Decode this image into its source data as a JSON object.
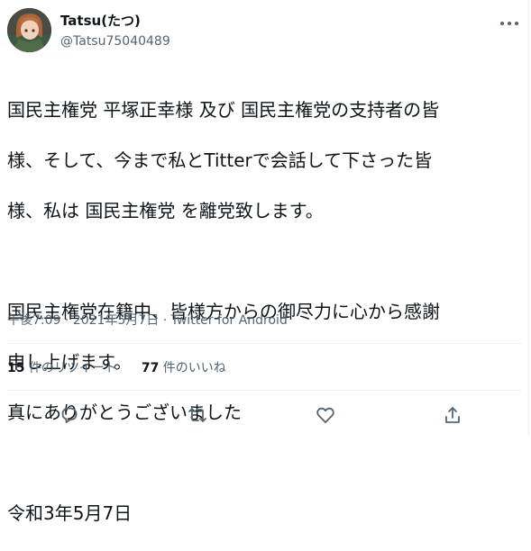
{
  "user": {
    "display_name": "Tatsu(たつ)",
    "handle": "@Tatsu75040489"
  },
  "tweet": {
    "lines": [
      "国民主権党 平塚正幸様 及び 国民主権党の支持者の皆",
      "様、そして、今まで私とTitterで会話して下さった皆",
      "様、私は 国民主権党 を離党致します。",
      "",
      "国民主権党在籍中、皆様方からの御尽力に心から感謝",
      "申し上げます。",
      "真にありがとうございました",
      "",
      "令和3年5月7日"
    ],
    "time": "午後7:09",
    "date": "2021年5月7日",
    "source": "Twitter for Android",
    "separator": "·"
  },
  "stats": {
    "retweets_count": "15",
    "retweets_label": "件のリツイート",
    "likes_count": "77",
    "likes_label": "件のいいね"
  },
  "icons": {
    "more": "more-icon",
    "reply": "reply-icon",
    "retweet": "retweet-icon",
    "like": "like-icon",
    "share": "share-icon"
  },
  "colors": {
    "text": "#0f1419",
    "secondary": "#536471",
    "divider": "#eff3f4"
  }
}
